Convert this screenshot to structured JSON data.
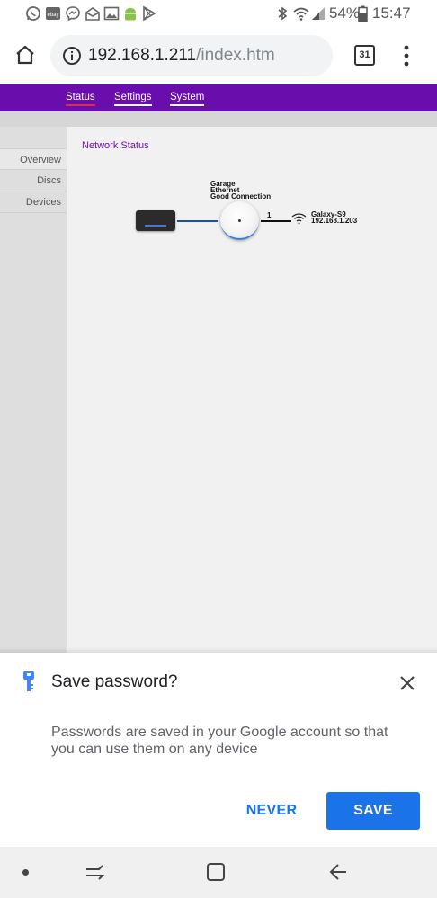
{
  "status_bar": {
    "battery_percent": "54%",
    "time": "15:47",
    "notification_icons": [
      "whatsapp-icon",
      "ebay-icon",
      "messenger-icon",
      "mail-icon",
      "gallery-icon",
      "android-icon",
      "play-store-icon"
    ],
    "system_icons": [
      "bluetooth-icon",
      "wifi-icon",
      "signal-icon",
      "battery-icon"
    ]
  },
  "browser": {
    "url_host": "192.168.1.211",
    "url_path": "/index.htm",
    "tab_count": "31"
  },
  "router_ui": {
    "nav": [
      "Status",
      "Settings",
      "System"
    ],
    "active_nav": "Status",
    "sidebar": [
      "Overview",
      "Discs",
      "Devices"
    ],
    "active_sidebar": "Overview",
    "section_title": "Network Status",
    "satellite": {
      "name": "Garage",
      "connection_type": "Ethernet",
      "connection_quality": "Good Connection"
    },
    "link_count": "1",
    "client": {
      "name": "Galaxy-S9",
      "ip": "192.168.1.203"
    },
    "colors": {
      "nav_bg": "#6a0dad",
      "active_underline": "#d9304d",
      "link_line": "#1f4fa0"
    }
  },
  "save_password": {
    "title": "Save password?",
    "body": "Passwords are saved in your Google account so that you can use them on any device",
    "never_label": "NEVER",
    "save_label": "SAVE",
    "accent": "#1a73e8"
  },
  "system_nav": {
    "buttons": [
      "dot-icon",
      "recents-icon",
      "home-icon",
      "back-icon"
    ]
  }
}
